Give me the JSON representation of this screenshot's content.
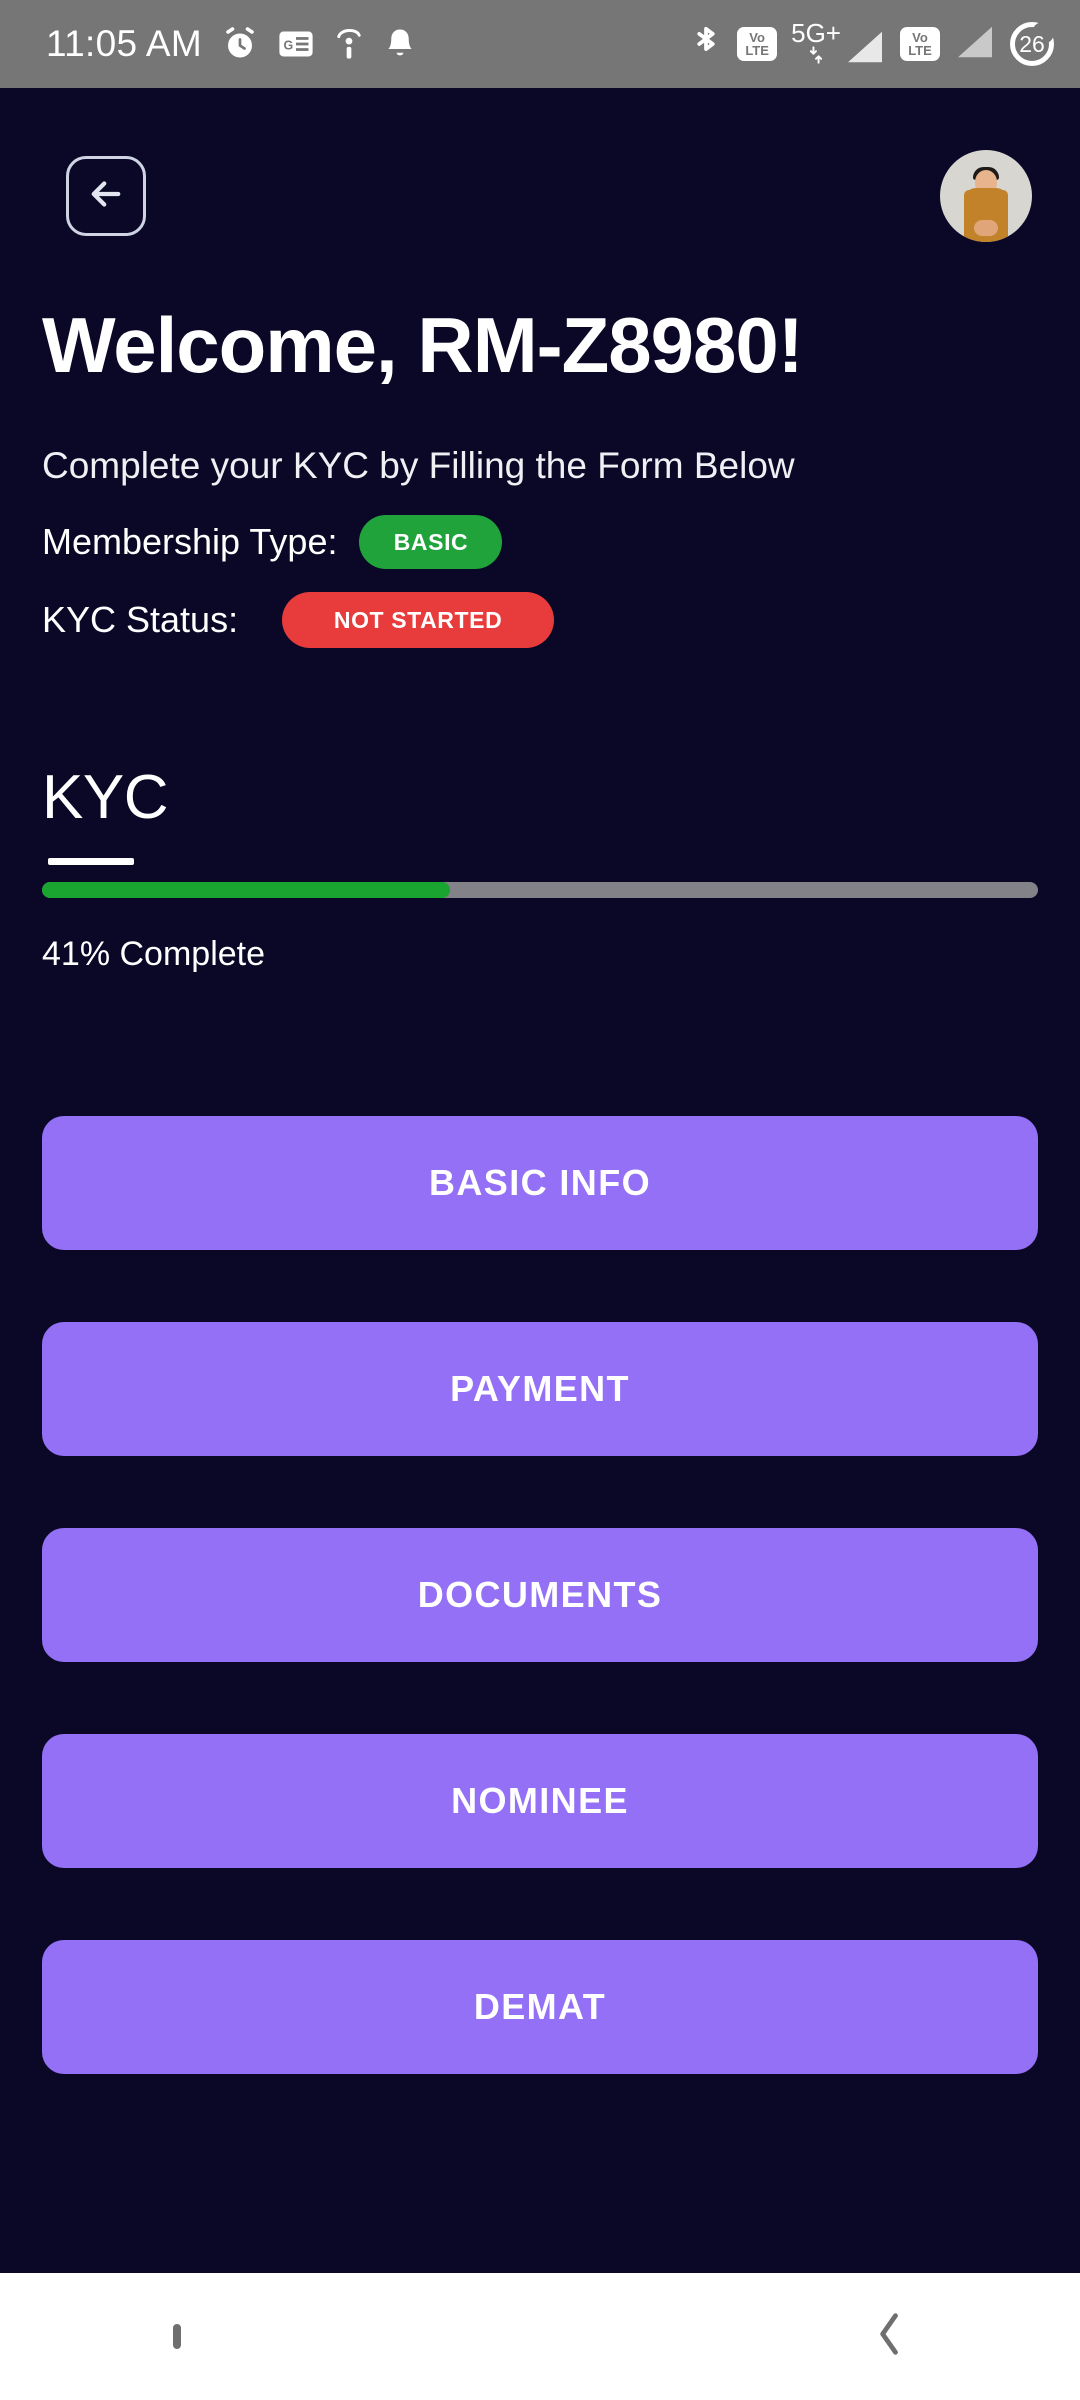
{
  "status_bar": {
    "time": "11:05 AM",
    "left_icons": [
      "alarm-clock-icon",
      "google-news-icon",
      "info-icon",
      "notification-bell-icon"
    ],
    "bluetooth_icon": "bluetooth-icon",
    "sim1_volte": "Vo\nLTE",
    "sim1_volte_line1": "Vo",
    "sim1_volte_line2": "LTE",
    "network_type": "5G+",
    "sim2_volte_line1": "Vo",
    "sim2_volte_line2": "LTE",
    "battery_percent": "26",
    "background_color": "#767676"
  },
  "header": {
    "back_icon": "arrow-left-icon",
    "avatar_label": "user-avatar"
  },
  "page": {
    "title": "Welcome, RM-Z8980!",
    "subtitle": "Complete your KYC by Filling the Form Below",
    "membership_label": "Membership Type:",
    "membership_value": "BASIC",
    "membership_color": "#21a33c",
    "kyc_status_label": "KYC Status:",
    "kyc_status_value": "NOT STARTED",
    "kyc_status_color": "#e83b3b",
    "background_color": "#0a0826"
  },
  "kyc": {
    "section_heading": "KYC",
    "progress_percent": 41,
    "progress_label": "41% Complete",
    "progress_fill_color": "#19a52f",
    "progress_track_color": "#828288"
  },
  "actions": {
    "accent_color": "#9370f5",
    "buttons": [
      {
        "label": "BASIC INFO"
      },
      {
        "label": "PAYMENT"
      },
      {
        "label": "DOCUMENTS"
      },
      {
        "label": "NOMINEE"
      },
      {
        "label": "DEMAT"
      }
    ]
  },
  "navbar": {
    "recents_icon": "square-recents-icon",
    "home_icon": "home-pill-icon",
    "back_icon": "chevron-left-icon",
    "background_color": "#ffffff"
  }
}
